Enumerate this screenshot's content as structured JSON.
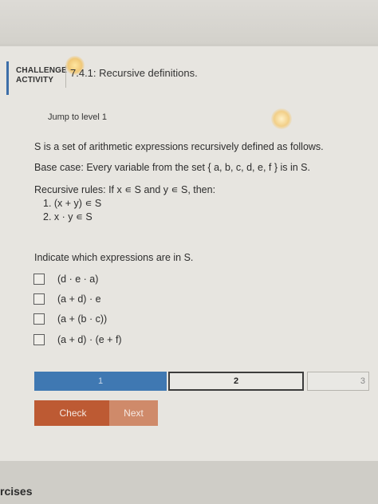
{
  "header": {
    "challenge_line1": "CHALLENGE",
    "challenge_line2": "ACTIVITY",
    "activity_title": "7.4.1: Recursive definitions."
  },
  "jump_link": "Jump to level 1",
  "problem": {
    "intro": "S is a set of arithmetic expressions recursively defined as follows.",
    "base_case": "Base case: Every variable from the set { a, b, c, d, e, f } is in S.",
    "recursive_intro": "Recursive rules: If x ∊ S and y ∊ S, then:",
    "rules": [
      "1. (x + y) ∊ S",
      "2. x · y ∊ S"
    ],
    "question": "Indicate which expressions are in S."
  },
  "options": [
    "(d · e · a)",
    "(a + d) · e",
    "(a + (b · c))",
    "(a + d) · (e + f)"
  ],
  "progress": {
    "level1": "1",
    "level2": "2",
    "level3": "3"
  },
  "buttons": {
    "check": "Check",
    "next": "Next"
  },
  "footer": {
    "partial_text": "rcises"
  },
  "colors": {
    "accent_blue": "#3f78b2",
    "check_button": "#bd5a33",
    "next_button": "#cf8a6a"
  }
}
